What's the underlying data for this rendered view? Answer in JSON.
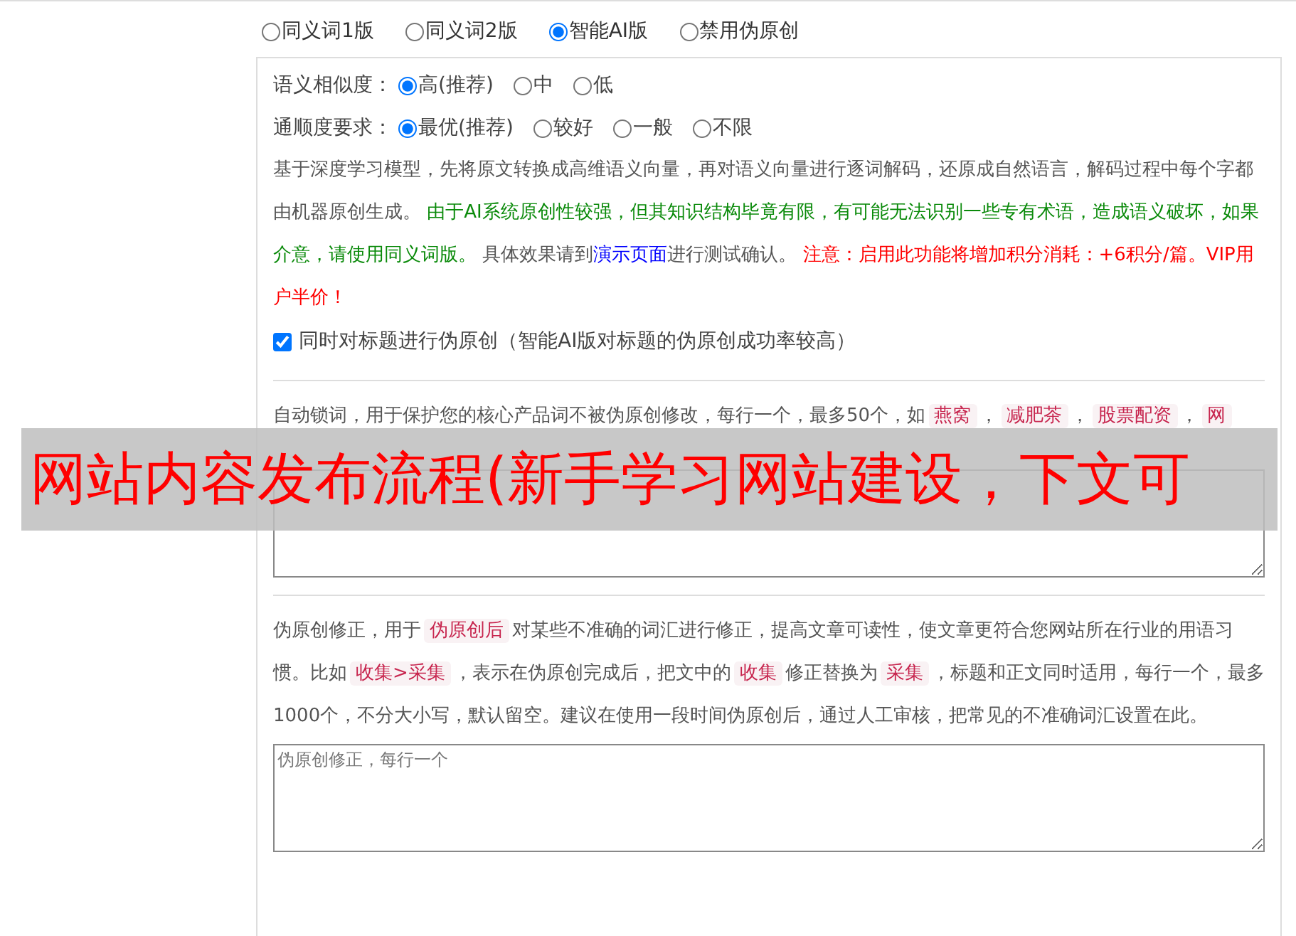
{
  "mode_options": [
    {
      "label": "同义词1版",
      "selected": false
    },
    {
      "label": "同义词2版",
      "selected": false
    },
    {
      "label": "智能AI版",
      "selected": true
    },
    {
      "label": "禁用伪原创",
      "selected": false
    }
  ],
  "settings": {
    "similarity": {
      "label": "语义相似度：",
      "options": [
        {
          "label": "高(推荐)",
          "selected": true
        },
        {
          "label": "中",
          "selected": false
        },
        {
          "label": "低",
          "selected": false
        }
      ]
    },
    "fluency": {
      "label": "通顺度要求：",
      "options": [
        {
          "label": "最优(推荐)",
          "selected": true
        },
        {
          "label": "较好",
          "selected": false
        },
        {
          "label": "一般",
          "selected": false
        },
        {
          "label": "不限",
          "selected": false
        }
      ]
    },
    "description": [
      {
        "kind": "text",
        "text": "基于深度学习模型，先将原文转换成高维语义向量，再对语义向量进行逐词解码，还原成自然语言，解码过程中每个字都由机器原创生成。 "
      },
      {
        "kind": "note",
        "text": "由于AI系统原创性较强，但其知识结构毕竟有限，有可能无法识别一些专有术语，造成语义破坏，如果介意，请使用同义词版。"
      },
      {
        "kind": "text",
        "text": " 具体效果请到"
      },
      {
        "kind": "link",
        "text": "演示页面"
      },
      {
        "kind": "text",
        "text": "进行测试确认。 "
      },
      {
        "kind": "warning",
        "text": "注意：启用此功能将增加积分消耗：+6积分/篇。VIP用户半价！"
      }
    ],
    "title_option": {
      "label": "同时对标题进行伪原创（智能AI版对标题的伪原创成功率较高）",
      "checked": true
    },
    "lock_words": {
      "description": [
        {
          "kind": "text",
          "text": "自动锁词，用于保护您的核心产品词不被伪原创修改，每行一个，最多50个，如"
        },
        {
          "kind": "tag",
          "text": "燕窝"
        },
        {
          "kind": "text",
          "text": "，"
        },
        {
          "kind": "tag",
          "text": "减肥茶"
        },
        {
          "kind": "text",
          "text": "，"
        },
        {
          "kind": "tag",
          "text": "股票配资"
        },
        {
          "kind": "text",
          "text": "，"
        },
        {
          "kind": "tag",
          "text": "网"
        }
      ]
    },
    "correction": {
      "description": [
        {
          "kind": "text",
          "text": "伪原创修正，用于"
        },
        {
          "kind": "tag",
          "text": "伪原创后"
        },
        {
          "kind": "text",
          "text": "对某些不准确的词汇进行修正，提高文章可读性，使文章更符合您网站所在行业的用语习惯。比如"
        },
        {
          "kind": "tag",
          "text": "收集>采集"
        },
        {
          "kind": "text",
          "text": "，表示在伪原创完成后，把文中的"
        },
        {
          "kind": "tag",
          "text": "收集"
        },
        {
          "kind": "text",
          "text": "修正替换为"
        },
        {
          "kind": "tag",
          "text": "采集"
        },
        {
          "kind": "text",
          "text": "，标题和正文同时适用，每行一个，最多1000个，不分大小写，默认留空。建议在使用一段时间伪原创后，通过人工审核，把常见的不准确词汇设置在此。"
        }
      ],
      "placeholder": "伪原创修正，每行一个"
    }
  },
  "overlay_banner": {
    "text": "网站内容发布流程(新手学习网站建设，下文可"
  }
}
